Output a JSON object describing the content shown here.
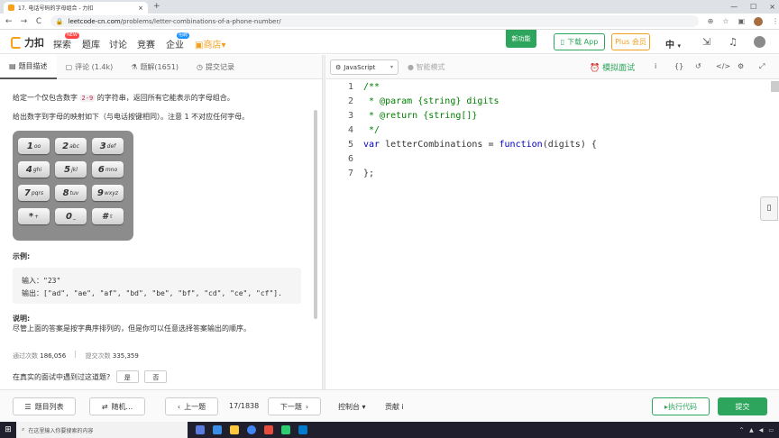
{
  "browser": {
    "tab_title": "17. 电话号码的字母组合 - 力扣",
    "tab_close": "×",
    "new_tab": "+",
    "window_controls": [
      "—",
      "☐",
      "×"
    ],
    "url_host": "leetcode-cn.com",
    "url_path": "/problems/letter-combinations-of-a-phone-number/",
    "nav": {
      "back": "←",
      "forward": "→",
      "reload": "C"
    }
  },
  "header": {
    "logo_text": "力扣",
    "nav": [
      {
        "label": "探索",
        "badge": "NEW"
      },
      {
        "label": "题库"
      },
      {
        "label": "讨论"
      },
      {
        "label": "竞赛"
      },
      {
        "label": "企业",
        "badge": "招聘"
      },
      {
        "label": "商店"
      }
    ],
    "new_feature": "新功能",
    "download_app": "下载 App",
    "plus": "Plus 会员",
    "lang": "中"
  },
  "left_tabs": [
    {
      "label": "题目描述",
      "active": true
    },
    {
      "label": "评论 (1.4k)"
    },
    {
      "label": "题解(1651)"
    },
    {
      "label": "提交记录"
    }
  ],
  "problem": {
    "desc1_a": "给定一个仅包含数字 ",
    "desc1_code": "2-9",
    "desc1_b": " 的字符串，返回所有它能表示的字母组合。",
    "desc2": "给出数字到字母的映射如下（与电话按键相同）。注意 1 不对应任何字母。",
    "keypad": [
      {
        "d": "1",
        "l": "oo"
      },
      {
        "d": "2",
        "l": "abc"
      },
      {
        "d": "3",
        "l": "def"
      },
      {
        "d": "4",
        "l": "ghi"
      },
      {
        "d": "5",
        "l": "jkl"
      },
      {
        "d": "6",
        "l": "mno"
      },
      {
        "d": "7",
        "l": "pqrs"
      },
      {
        "d": "8",
        "l": "tuv"
      },
      {
        "d": "9",
        "l": "wxyz"
      },
      {
        "d": "*",
        "l": "+"
      },
      {
        "d": "0",
        "l": "_"
      },
      {
        "d": "#",
        "l": "⇧"
      }
    ],
    "example_title": "示例:",
    "example_input": "输入：\"23\"",
    "example_output": "输出：[\"ad\", \"ae\", \"af\", \"bd\", \"be\", \"bf\", \"cd\", \"ce\", \"cf\"].",
    "note_title": "说明:",
    "note_text": "尽管上面的答案是按字典序排列的，但是你可以任意选择答案输出的顺序。",
    "passed_label": "通过次数",
    "passed_value": "186,056",
    "submitted_label": "提交次数",
    "submitted_value": "335,359",
    "question": "在真实的面试中遇到过这道题?",
    "yes": "是",
    "no": "否"
  },
  "editor": {
    "language": "JavaScript",
    "smart_mode": "智能模式",
    "mock_interview": "模拟面试",
    "lines": [
      {
        "n": "1",
        "text": "/**",
        "cls": "cmt"
      },
      {
        "n": "2",
        "text": " * @param {string} digits",
        "cls": "cmt"
      },
      {
        "n": "3",
        "text": " * @return {string[]}",
        "cls": "cmt"
      },
      {
        "n": "4",
        "text": " */",
        "cls": "cmt"
      },
      {
        "n": "5",
        "text": "var letterCombinations = function(digits) {",
        "cls": ""
      },
      {
        "n": "6",
        "text": "",
        "cls": ""
      },
      {
        "n": "7",
        "text": "};",
        "cls": ""
      }
    ]
  },
  "bottom": {
    "problem_list": "题目列表",
    "random": "随机...",
    "prev": "上一题",
    "page": "17/1838",
    "next": "下一题",
    "console": "控制台",
    "contribute": "贡献 i",
    "run": "▸执行代码",
    "submit": "提交"
  },
  "taskbar": {
    "search_placeholder": "在这里输入你要搜索的内容"
  }
}
